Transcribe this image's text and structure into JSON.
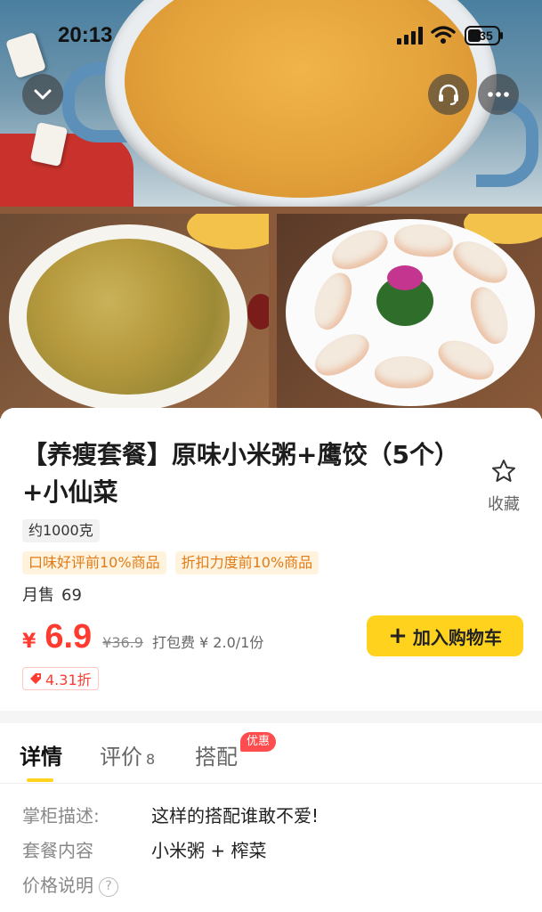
{
  "status_bar": {
    "time": "20:13",
    "battery": "35"
  },
  "hero": {
    "collapse_icon": "chevron-down-icon",
    "service_icon": "customer-service-icon",
    "more_icon": "more-icon"
  },
  "product": {
    "title": "【养瘦套餐】原味小米粥+鹰饺（5个）+小仙菜",
    "favorite_label": "收藏",
    "weight": "约1000克",
    "rank_tags": [
      "口味好评前10%商品",
      "折扣力度前10%商品"
    ],
    "sales_label": "月售",
    "sales_count": "69",
    "currency": "¥",
    "price": "6.9",
    "original_price": "¥36.9",
    "packing_fee": "打包费 ¥ 2.0/1份",
    "add_to_cart": "加入购物车",
    "discount": "4.31折"
  },
  "tabs": {
    "detail": "详情",
    "reviews": "评价",
    "reviews_count": "8",
    "combo": "搭配",
    "combo_badge": "优惠"
  },
  "details": [
    {
      "key": "掌柜描述:",
      "value": "这样的搭配谁敢不爱!"
    },
    {
      "key": "套餐内容",
      "value": "小米粥 + 榨菜"
    },
    {
      "key": "价格说明",
      "value": ""
    }
  ],
  "colors": {
    "accent_yellow": "#ffd21e",
    "price_red": "#ff3b30",
    "tag_orange": "#e07b18"
  }
}
